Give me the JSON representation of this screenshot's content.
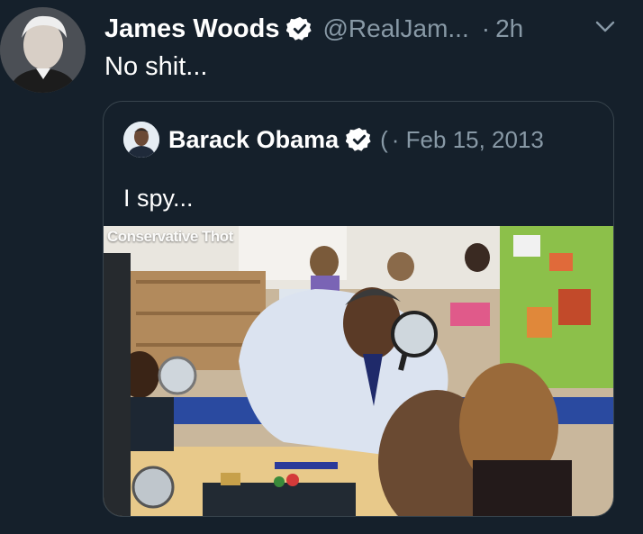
{
  "tweet": {
    "author_name": "James Woods",
    "author_handle": "@RealJam...",
    "separator": "·",
    "time": "2h",
    "text": "No shit...",
    "avatar_icon": "avatar-photo",
    "verified_icon": "verified-badge-icon",
    "menu_icon": "chevron-down-icon"
  },
  "quoted": {
    "author_name": "Barack Obama",
    "author_handle": "(",
    "date": "· Feb 15, 2013",
    "text": "I spy...",
    "avatar_icon": "avatar-photo",
    "verified_icon": "verified-badge-icon",
    "image_watermark": "Conservative Thot"
  },
  "colors": {
    "background": "#15202b",
    "secondary_text": "#8899a6",
    "border": "#38444d",
    "verified_badge": "#ffffff"
  }
}
